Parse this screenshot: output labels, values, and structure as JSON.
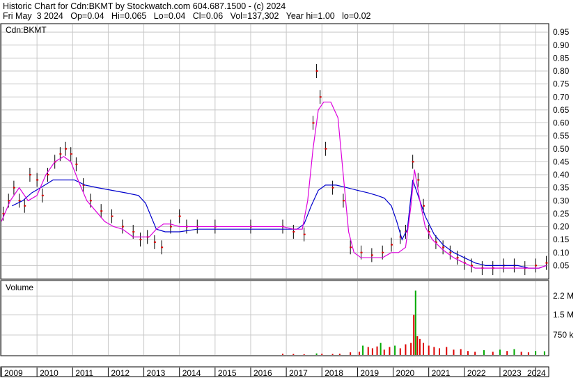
{
  "header": {
    "line1": "Historic Chart for Cdn:BKMT by Stockwatch.com 604.687.1500 - (c) 2024",
    "line2": "Fri May  3 2024   Op=0.04   Hi=0.065   Lo=0.04   Cl=0.06   Vol=137,302   Year hi=1.00   lo=0.02"
  },
  "colors": {
    "grid": "#c8c8c8",
    "price_bars": "#000000",
    "close_marker": "#dd0000",
    "ma_short": "#dd00dd",
    "ma_long": "#0000cc",
    "volume_up": "#00aa00",
    "volume_down": "#dd0000",
    "volume_flat": "#999999"
  },
  "chart_data": [
    {
      "type": "line",
      "label": "Cdn:BKMT",
      "y_ticks": [
        "0.95",
        "0.90",
        "0.85",
        "0.80",
        "0.75",
        "0.70",
        "0.65",
        "0.60",
        "0.55",
        "0.50",
        "0.45",
        "0.40",
        "0.35",
        "0.30",
        "0.25",
        "0.20",
        "0.15",
        "0.10",
        "0.05"
      ],
      "ylim": [
        0,
        0.98
      ],
      "x_ticks": [
        "2009",
        "2010",
        "2011",
        "2012",
        "2013",
        "2014",
        "2015",
        "2016",
        "2017",
        "2018",
        "2019",
        "2020",
        "2021",
        "2022",
        "2023",
        "2024"
      ],
      "xlim": [
        2009.0,
        2024.35
      ],
      "series": [
        {
          "role": "price_range",
          "points": [
            [
              2009.05,
              0.25
            ],
            [
              2009.2,
              0.3
            ],
            [
              2009.35,
              0.35
            ],
            [
              2009.5,
              0.3
            ],
            [
              2009.65,
              0.28
            ],
            [
              2009.8,
              0.4
            ],
            [
              2010.0,
              0.38
            ],
            [
              2010.15,
              0.32
            ],
            [
              2010.3,
              0.4
            ],
            [
              2010.5,
              0.45
            ],
            [
              2010.65,
              0.48
            ],
            [
              2010.8,
              0.5
            ],
            [
              2010.95,
              0.48
            ],
            [
              2011.1,
              0.44
            ],
            [
              2011.3,
              0.36
            ],
            [
              2011.5,
              0.3
            ],
            [
              2011.8,
              0.26
            ],
            [
              2012.1,
              0.24
            ],
            [
              2012.4,
              0.2
            ],
            [
              2012.7,
              0.18
            ],
            [
              2012.9,
              0.15
            ],
            [
              2013.1,
              0.16
            ],
            [
              2013.3,
              0.14
            ],
            [
              2013.5,
              0.12
            ],
            [
              2013.75,
              0.2
            ],
            [
              2014.0,
              0.24
            ],
            [
              2014.2,
              0.2
            ],
            [
              2014.5,
              0.2
            ],
            [
              2015.0,
              0.2
            ],
            [
              2016.0,
              0.2
            ],
            [
              2016.9,
              0.2
            ],
            [
              2017.2,
              0.18
            ],
            [
              2017.5,
              0.17
            ],
            [
              2017.75,
              0.6
            ],
            [
              2017.85,
              0.8
            ],
            [
              2017.95,
              0.7
            ],
            [
              2018.1,
              0.5
            ],
            [
              2018.3,
              0.35
            ],
            [
              2018.6,
              0.3
            ],
            [
              2018.8,
              0.12
            ],
            [
              2019.1,
              0.1
            ],
            [
              2019.4,
              0.09
            ],
            [
              2019.7,
              0.1
            ],
            [
              2019.95,
              0.13
            ],
            [
              2020.2,
              0.16
            ],
            [
              2020.35,
              0.18
            ],
            [
              2020.55,
              0.45
            ],
            [
              2020.7,
              0.38
            ],
            [
              2020.85,
              0.28
            ],
            [
              2021.0,
              0.18
            ],
            [
              2021.2,
              0.14
            ],
            [
              2021.4,
              0.12
            ],
            [
              2021.6,
              0.1
            ],
            [
              2021.8,
              0.08
            ],
            [
              2022.0,
              0.06
            ],
            [
              2022.2,
              0.05
            ],
            [
              2022.5,
              0.04
            ],
            [
              2022.8,
              0.04
            ],
            [
              2023.1,
              0.05
            ],
            [
              2023.4,
              0.05
            ],
            [
              2023.7,
              0.04
            ],
            [
              2024.0,
              0.05
            ],
            [
              2024.3,
              0.06
            ]
          ]
        },
        {
          "role": "moving_average_short",
          "points": [
            [
              2009.0,
              0.22
            ],
            [
              2009.25,
              0.3
            ],
            [
              2009.5,
              0.35
            ],
            [
              2009.75,
              0.3
            ],
            [
              2010.0,
              0.32
            ],
            [
              2010.25,
              0.4
            ],
            [
              2010.5,
              0.45
            ],
            [
              2010.75,
              0.47
            ],
            [
              2010.95,
              0.45
            ],
            [
              2011.15,
              0.38
            ],
            [
              2011.4,
              0.3
            ],
            [
              2011.65,
              0.26
            ],
            [
              2011.9,
              0.22
            ],
            [
              2012.15,
              0.2
            ],
            [
              2012.4,
              0.19
            ],
            [
              2012.7,
              0.16
            ],
            [
              2013.0,
              0.16
            ],
            [
              2013.15,
              0.16
            ],
            [
              2013.35,
              0.19
            ],
            [
              2013.55,
              0.21
            ],
            [
              2013.75,
              0.21
            ],
            [
              2014.0,
              0.2
            ],
            [
              2015.0,
              0.2
            ],
            [
              2016.0,
              0.2
            ],
            [
              2016.9,
              0.2
            ],
            [
              2017.2,
              0.19
            ],
            [
              2017.45,
              0.19
            ],
            [
              2017.6,
              0.3
            ],
            [
              2017.75,
              0.5
            ],
            [
              2017.9,
              0.65
            ],
            [
              2018.05,
              0.68
            ],
            [
              2018.25,
              0.68
            ],
            [
              2018.45,
              0.62
            ],
            [
              2018.6,
              0.4
            ],
            [
              2018.75,
              0.18
            ],
            [
              2018.9,
              0.1
            ],
            [
              2019.1,
              0.08
            ],
            [
              2019.4,
              0.08
            ],
            [
              2019.7,
              0.08
            ],
            [
              2019.95,
              0.1
            ],
            [
              2020.15,
              0.1
            ],
            [
              2020.35,
              0.12
            ],
            [
              2020.5,
              0.28
            ],
            [
              2020.6,
              0.42
            ],
            [
              2020.75,
              0.3
            ],
            [
              2020.9,
              0.2
            ],
            [
              2021.1,
              0.15
            ],
            [
              2021.4,
              0.11
            ],
            [
              2021.7,
              0.08
            ],
            [
              2022.0,
              0.06
            ],
            [
              2022.3,
              0.04
            ],
            [
              2022.7,
              0.04
            ],
            [
              2023.0,
              0.04
            ],
            [
              2023.4,
              0.04
            ],
            [
              2023.8,
              0.04
            ],
            [
              2024.1,
              0.04
            ],
            [
              2024.3,
              0.05
            ]
          ]
        },
        {
          "role": "moving_average_long",
          "points": [
            [
              2009.3,
              0.28
            ],
            [
              2009.6,
              0.3
            ],
            [
              2009.85,
              0.33
            ],
            [
              2010.1,
              0.35
            ],
            [
              2010.45,
              0.38
            ],
            [
              2010.75,
              0.38
            ],
            [
              2011.05,
              0.38
            ],
            [
              2011.35,
              0.36
            ],
            [
              2011.7,
              0.35
            ],
            [
              2012.1,
              0.34
            ],
            [
              2012.5,
              0.33
            ],
            [
              2012.85,
              0.32
            ],
            [
              2013.05,
              0.29
            ],
            [
              2013.2,
              0.24
            ],
            [
              2013.35,
              0.19
            ],
            [
              2013.6,
              0.18
            ],
            [
              2014.0,
              0.18
            ],
            [
              2014.5,
              0.19
            ],
            [
              2015.0,
              0.19
            ],
            [
              2016.0,
              0.19
            ],
            [
              2016.8,
              0.19
            ],
            [
              2017.3,
              0.19
            ],
            [
              2017.5,
              0.21
            ],
            [
              2017.7,
              0.28
            ],
            [
              2017.9,
              0.34
            ],
            [
              2018.1,
              0.36
            ],
            [
              2018.4,
              0.36
            ],
            [
              2018.7,
              0.35
            ],
            [
              2019.0,
              0.34
            ],
            [
              2019.3,
              0.33
            ],
            [
              2019.55,
              0.32
            ],
            [
              2019.75,
              0.31
            ],
            [
              2019.95,
              0.28
            ],
            [
              2020.1,
              0.22
            ],
            [
              2020.25,
              0.15
            ],
            [
              2020.4,
              0.19
            ],
            [
              2020.55,
              0.38
            ],
            [
              2020.7,
              0.32
            ],
            [
              2020.9,
              0.24
            ],
            [
              2021.15,
              0.17
            ],
            [
              2021.4,
              0.13
            ],
            [
              2021.7,
              0.1
            ],
            [
              2022.0,
              0.08
            ],
            [
              2022.3,
              0.06
            ],
            [
              2022.6,
              0.05
            ],
            [
              2022.9,
              0.05
            ],
            [
              2023.2,
              0.05
            ],
            [
              2023.5,
              0.05
            ],
            [
              2023.8,
              0.04
            ],
            [
              2024.1,
              0.04
            ],
            [
              2024.3,
              0.05
            ]
          ]
        }
      ]
    },
    {
      "type": "bar",
      "label": "Volume",
      "y_ticks": [
        "2.2 M",
        "1.5 M",
        "750 k"
      ],
      "ylim": [
        0,
        2.75
      ],
      "unit_hint": "M",
      "bars": [
        {
          "x": 2016.9,
          "v": 0.05,
          "dir": "down"
        },
        {
          "x": 2017.2,
          "v": 0.04,
          "dir": "down"
        },
        {
          "x": 2017.5,
          "v": 0.03,
          "dir": "down"
        },
        {
          "x": 2017.85,
          "v": 0.06,
          "dir": "up"
        },
        {
          "x": 2018.0,
          "v": 0.05,
          "dir": "down"
        },
        {
          "x": 2018.3,
          "v": 0.04,
          "dir": "down"
        },
        {
          "x": 2018.5,
          "v": 0.05,
          "dir": "down"
        },
        {
          "x": 2018.8,
          "v": 0.1,
          "dir": "down"
        },
        {
          "x": 2019.05,
          "v": 0.12,
          "dir": "down"
        },
        {
          "x": 2019.15,
          "v": 0.35,
          "dir": "up"
        },
        {
          "x": 2019.3,
          "v": 0.3,
          "dir": "down"
        },
        {
          "x": 2019.42,
          "v": 0.25,
          "dir": "down"
        },
        {
          "x": 2019.55,
          "v": 0.32,
          "dir": "down"
        },
        {
          "x": 2019.65,
          "v": 0.45,
          "dir": "up"
        },
        {
          "x": 2019.75,
          "v": 0.2,
          "dir": "down"
        },
        {
          "x": 2019.9,
          "v": 0.3,
          "dir": "down"
        },
        {
          "x": 2020.05,
          "v": 0.35,
          "dir": "up"
        },
        {
          "x": 2020.2,
          "v": 0.25,
          "dir": "down"
        },
        {
          "x": 2020.35,
          "v": 0.4,
          "dir": "down"
        },
        {
          "x": 2020.5,
          "v": 0.45,
          "dir": "down"
        },
        {
          "x": 2020.58,
          "v": 1.5,
          "dir": "down"
        },
        {
          "x": 2020.63,
          "v": 2.4,
          "dir": "up"
        },
        {
          "x": 2020.68,
          "v": 0.7,
          "dir": "down"
        },
        {
          "x": 2020.75,
          "v": 0.6,
          "dir": "down"
        },
        {
          "x": 2020.85,
          "v": 0.45,
          "dir": "down"
        },
        {
          "x": 2021.0,
          "v": 0.35,
          "dir": "down"
        },
        {
          "x": 2021.15,
          "v": 0.3,
          "dir": "down"
        },
        {
          "x": 2021.3,
          "v": 0.25,
          "dir": "down"
        },
        {
          "x": 2021.5,
          "v": 0.3,
          "dir": "down"
        },
        {
          "x": 2021.7,
          "v": 0.2,
          "dir": "down"
        },
        {
          "x": 2021.9,
          "v": 0.22,
          "dir": "down"
        },
        {
          "x": 2022.1,
          "v": 0.15,
          "dir": "down"
        },
        {
          "x": 2022.3,
          "v": 0.12,
          "dir": "down"
        },
        {
          "x": 2022.55,
          "v": 0.18,
          "dir": "up"
        },
        {
          "x": 2022.8,
          "v": 0.12,
          "dir": "down"
        },
        {
          "x": 2023.0,
          "v": 0.2,
          "dir": "up"
        },
        {
          "x": 2023.2,
          "v": 0.15,
          "dir": "down"
        },
        {
          "x": 2023.4,
          "v": 0.22,
          "dir": "up"
        },
        {
          "x": 2023.6,
          "v": 0.12,
          "dir": "down"
        },
        {
          "x": 2023.8,
          "v": 0.1,
          "dir": "down"
        },
        {
          "x": 2024.0,
          "v": 0.15,
          "dir": "up"
        },
        {
          "x": 2024.25,
          "v": 0.14,
          "dir": "up"
        }
      ]
    }
  ]
}
